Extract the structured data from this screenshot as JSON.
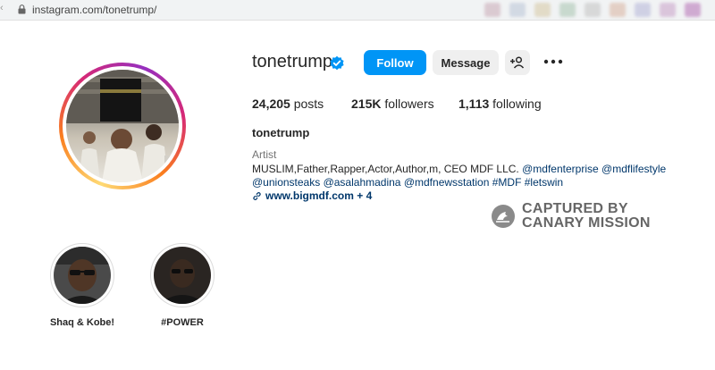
{
  "browser": {
    "url": "instagram.com/tonetrump/"
  },
  "profile": {
    "username": "tonetrump",
    "verified_icon": "verified-badge-icon",
    "follow_label": "Follow",
    "message_label": "Message",
    "stats": {
      "posts_count": "24,205",
      "posts_label": "posts",
      "followers_count": "215K",
      "followers_label": "followers",
      "following_count": "1,113",
      "following_label": "following"
    },
    "display_name": "tonetrump",
    "category": "Artist",
    "bio_text": "MUSLIM,Father,Rapper,Actor,Author,m, CEO MDF LLC.",
    "bio_mention_1": "@mdfenterprise",
    "bio_mention_2": "@mdflifestyle",
    "bio_mention_3": "@unionsteaks",
    "bio_mention_4": "@asalahmadina",
    "bio_mention_5": "@mdfnewsstation",
    "bio_hashtag_1": "#MDF",
    "bio_hashtag_2": "#letswin",
    "link_text": "www.bigmdf.com",
    "link_more": "+ 4"
  },
  "watermark": {
    "line1": "CAPTURED BY",
    "line2": "CANARY MISSION"
  },
  "highlights": [
    {
      "label": "Shaq & Kobe!"
    },
    {
      "label": "#POWER"
    }
  ],
  "colors": {
    "accent": "#0095f6",
    "link": "#00376b",
    "secondary_text": "#737373"
  }
}
